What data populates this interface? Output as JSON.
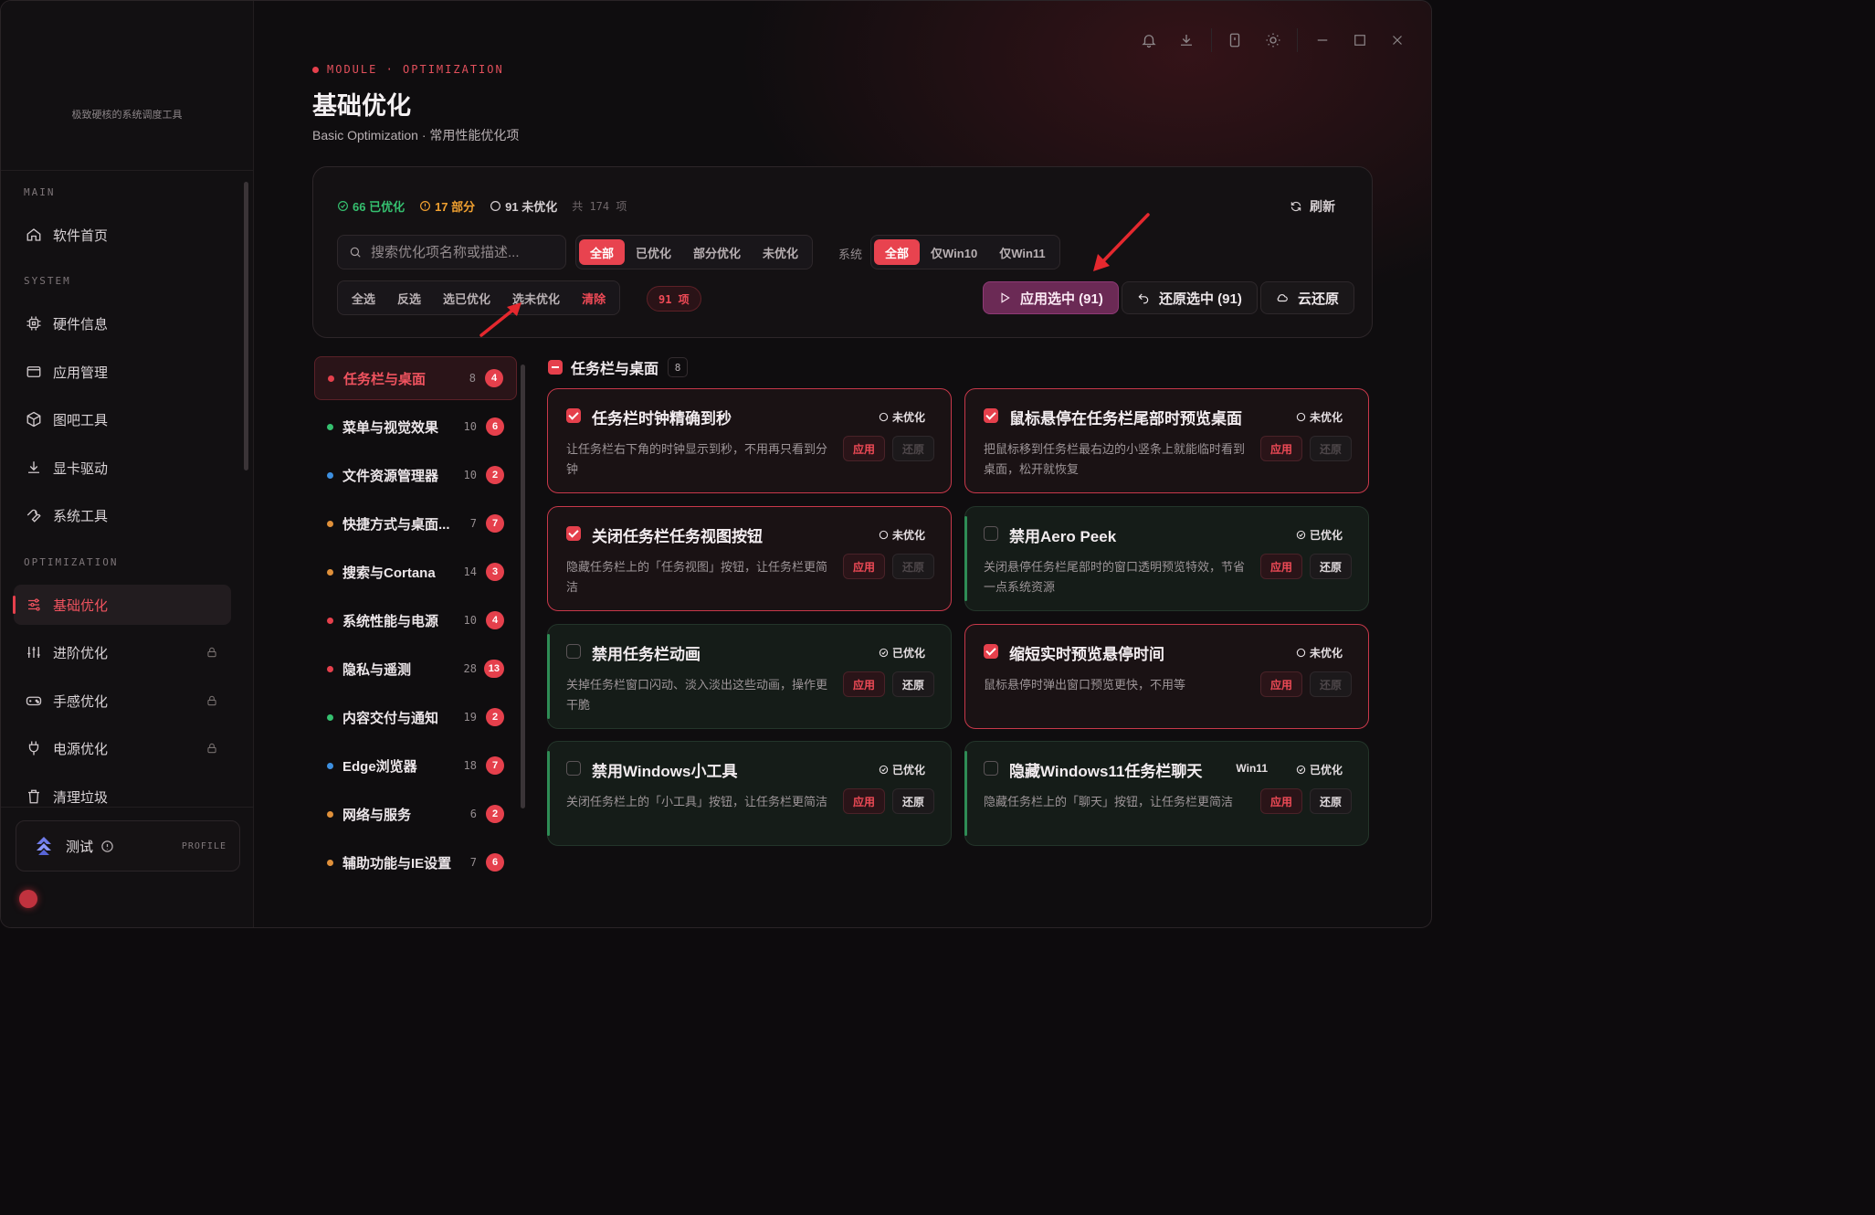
{
  "colors": {
    "accent": "#e5404c",
    "accent_text": "#f0535f",
    "success": "#35c06f",
    "warning": "#f0a030",
    "primary_button": "#6b2a55"
  },
  "sidebar": {
    "tagline": "极致硬核的系统调度工具",
    "sections": {
      "main": "MAIN",
      "system": "SYSTEM",
      "optimization": "OPTIMIZATION"
    },
    "items": [
      {
        "label": "软件首页",
        "icon": "home-icon"
      },
      {
        "label": "硬件信息",
        "icon": "cpu-icon"
      },
      {
        "label": "应用管理",
        "icon": "window-icon"
      },
      {
        "label": "图吧工具",
        "icon": "box-icon"
      },
      {
        "label": "显卡驱动",
        "icon": "download-icon"
      },
      {
        "label": "系统工具",
        "icon": "wrench-icon"
      },
      {
        "label": "基础优化",
        "icon": "sliders-icon",
        "active": true
      },
      {
        "label": "进阶优化",
        "icon": "equalizer-icon",
        "locked": true
      },
      {
        "label": "手感优化",
        "icon": "gamepad-icon",
        "locked": true
      },
      {
        "label": "电源优化",
        "icon": "plug-icon",
        "locked": true
      },
      {
        "label": "清理垃圾",
        "icon": "trash-icon"
      }
    ],
    "profile": {
      "name": "测试",
      "tag": "PROFILE"
    }
  },
  "header": {
    "eyebrow": "MODULE · OPTIMIZATION",
    "title": "基础优化",
    "subtitle": "Basic Optimization · 常用性能优化项"
  },
  "stats": {
    "optimized": "66 已优化",
    "partial": "17 部分",
    "unoptimized": "91 未优化",
    "total": "共 174 项"
  },
  "toolbar": {
    "refresh": "刷新",
    "search_placeholder": "搜索优化项名称或描述...",
    "status_filters": [
      "全部",
      "已优化",
      "部分优化",
      "未优化"
    ],
    "system_label": "系统",
    "system_filters": [
      "全部",
      "仅Win10",
      "仅Win11"
    ],
    "selection_actions": [
      "全选",
      "反选",
      "选已优化",
      "选未优化",
      "清除"
    ],
    "selected_count": "91 项",
    "apply_selected": "应用选中 (91)",
    "restore_selected": "还原选中 (91)",
    "cloud_restore": "云还原"
  },
  "categories": [
    {
      "name": "任务栏与桌面",
      "total": "8",
      "pending": "4",
      "color": "#e5404c",
      "active": true
    },
    {
      "name": "菜单与视觉效果",
      "total": "10",
      "pending": "6",
      "color": "#35c06f"
    },
    {
      "name": "文件资源管理器",
      "total": "10",
      "pending": "2",
      "color": "#3d8fe0"
    },
    {
      "name": "快捷方式与桌面...",
      "total": "7",
      "pending": "7",
      "color": "#e0903a"
    },
    {
      "name": "搜索与Cortana",
      "total": "14",
      "pending": "3",
      "color": "#e0903a"
    },
    {
      "name": "系统性能与电源",
      "total": "10",
      "pending": "4",
      "color": "#e5404c"
    },
    {
      "name": "隐私与遥测",
      "total": "28",
      "pending": "13",
      "color": "#e5404c"
    },
    {
      "name": "内容交付与通知",
      "total": "19",
      "pending": "2",
      "color": "#35c06f"
    },
    {
      "name": "Edge浏览器",
      "total": "18",
      "pending": "7",
      "color": "#3d8fe0"
    },
    {
      "name": "网络与服务",
      "total": "6",
      "pending": "2",
      "color": "#e0903a"
    },
    {
      "name": "辅助功能与IE设置",
      "total": "7",
      "pending": "6",
      "color": "#e0903a"
    }
  ],
  "group": {
    "name": "任务栏与桌面",
    "count": "8"
  },
  "cards": [
    {
      "title": "任务栏时钟精确到秒",
      "status": "未优化",
      "checked": true,
      "optimized": false,
      "desc": "让任务栏右下角的时钟显示到秒，不用再只看到分钟",
      "apply": "应用",
      "restore": "还原",
      "tag": ""
    },
    {
      "title": "鼠标悬停在任务栏尾部时预览桌面",
      "status": "未优化",
      "checked": true,
      "optimized": false,
      "desc": "把鼠标移到任务栏最右边的小竖条上就能临时看到桌面，松开就恢复",
      "apply": "应用",
      "restore": "还原",
      "tag": ""
    },
    {
      "title": "关闭任务栏任务视图按钮",
      "status": "未优化",
      "checked": true,
      "optimized": false,
      "desc": "隐藏任务栏上的「任务视图」按钮，让任务栏更简洁",
      "apply": "应用",
      "restore": "还原",
      "tag": ""
    },
    {
      "title": "禁用Aero Peek",
      "status": "已优化",
      "checked": false,
      "optimized": true,
      "desc": "关闭悬停任务栏尾部时的窗口透明预览特效，节省一点系统资源",
      "apply": "应用",
      "restore": "还原",
      "tag": ""
    },
    {
      "title": "禁用任务栏动画",
      "status": "已优化",
      "checked": false,
      "optimized": true,
      "desc": "关掉任务栏窗口闪动、淡入淡出这些动画，操作更干脆",
      "apply": "应用",
      "restore": "还原",
      "tag": ""
    },
    {
      "title": "缩短实时预览悬停时间",
      "status": "未优化",
      "checked": true,
      "optimized": false,
      "desc": "鼠标悬停时弹出窗口预览更快，不用等",
      "apply": "应用",
      "restore": "还原",
      "tag": ""
    },
    {
      "title": "禁用Windows小工具",
      "status": "已优化",
      "checked": false,
      "optimized": true,
      "desc": "关闭任务栏上的「小工具」按钮，让任务栏更简洁",
      "apply": "应用",
      "restore": "还原",
      "tag": ""
    },
    {
      "title": "隐藏Windows11任务栏聊天",
      "status": "已优化",
      "checked": false,
      "optimized": true,
      "desc": "隐藏任务栏上的「聊天」按钮，让任务栏更简洁",
      "apply": "应用",
      "restore": "还原",
      "tag": "Win11"
    }
  ]
}
